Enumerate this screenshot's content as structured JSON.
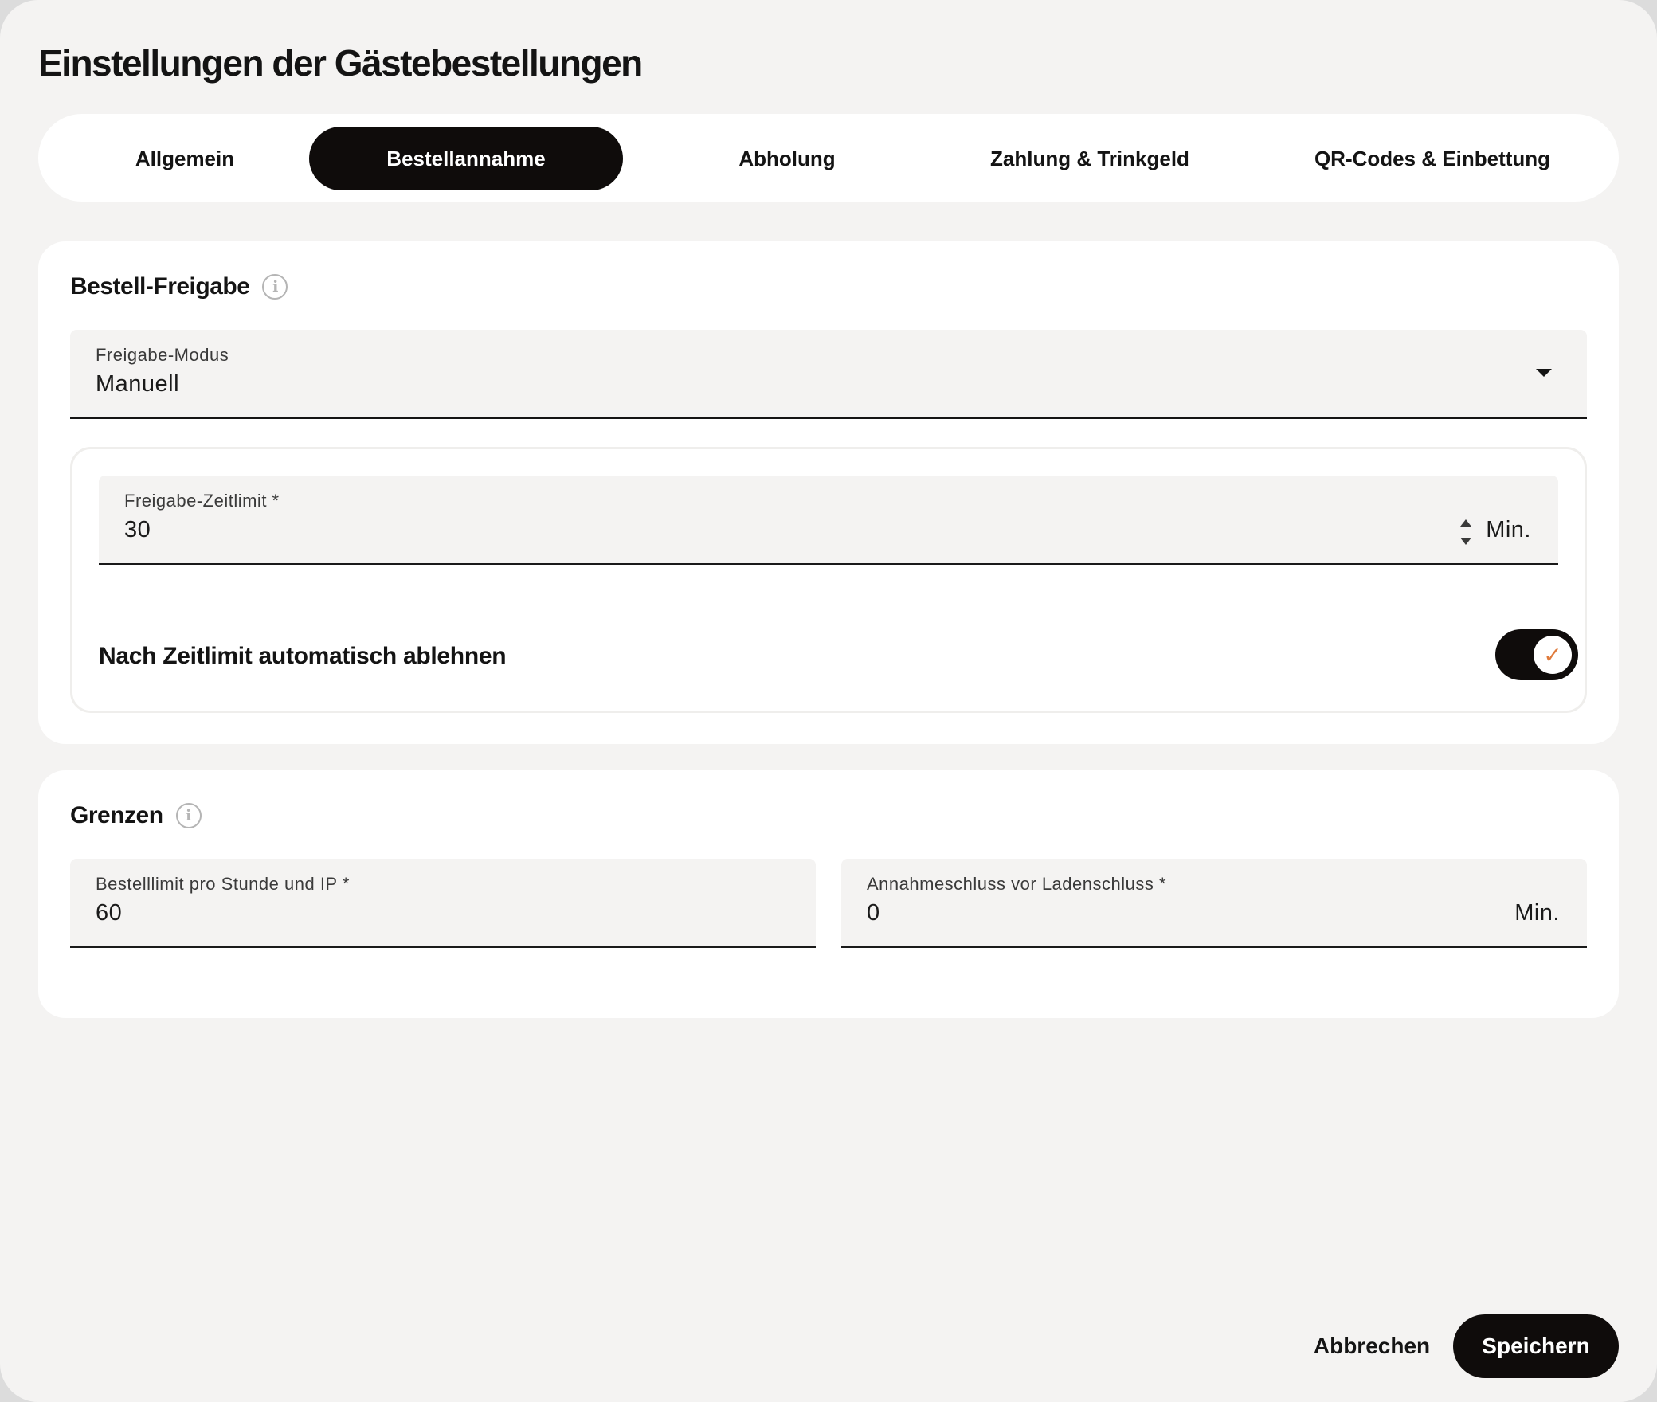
{
  "dialog": {
    "title": "Einstellungen der Gästebestellungen"
  },
  "tabs": [
    {
      "label": "Allgemein",
      "active": false
    },
    {
      "label": "Bestellannahme",
      "active": true
    },
    {
      "label": "Abholung",
      "active": false
    },
    {
      "label": "Zahlung & Trinkgeld",
      "active": false
    },
    {
      "label": "QR-Codes & Einbettung",
      "active": false
    }
  ],
  "release": {
    "title": "Bestell-Freigabe",
    "mode": {
      "label": "Freigabe-Modus",
      "value": "Manuell"
    },
    "timelimit": {
      "label": "Freigabe-Zeitlimit *",
      "value": "30",
      "unit": "Min."
    },
    "auto_reject": {
      "label": "Nach Zeitlimit automatisch ablehnen",
      "enabled": true
    }
  },
  "limits": {
    "title": "Grenzen",
    "order_limit": {
      "label": "Bestelllimit pro Stunde und IP *",
      "value": "60"
    },
    "cutoff": {
      "label": "Annahmeschluss vor Ladenschluss *",
      "value": "0",
      "unit": "Min."
    }
  },
  "footer": {
    "cancel_label": "Abbrechen",
    "save_label": "Speichern"
  },
  "colors": {
    "accent": "#0f0c0b",
    "background": "#f4f3f2",
    "check": "#e07b3c"
  }
}
